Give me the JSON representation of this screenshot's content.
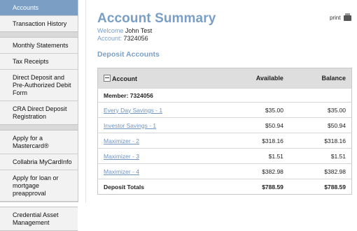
{
  "sidebar": {
    "groups": [
      {
        "items": [
          {
            "label": "Accounts"
          },
          {
            "label": "Transaction History"
          }
        ]
      },
      {
        "items": [
          {
            "label": "Monthly Statements"
          },
          {
            "label": "Tax Receipts"
          },
          {
            "label": "Direct Deposit and Pre-Authorized Debit Form"
          },
          {
            "label": "CRA Direct Deposit Registration"
          }
        ]
      },
      {
        "items": [
          {
            "label": "Apply for a Mastercard®"
          },
          {
            "label": "Collabria MyCardInfo"
          },
          {
            "label": "Apply for loan or mortgage preapproval"
          }
        ]
      },
      {
        "items": [
          {
            "label": "Credential Asset Management"
          }
        ]
      }
    ]
  },
  "header": {
    "title": "Account Summary",
    "print_label": "print",
    "welcome_label": "Welcome",
    "welcome_name": "John Test",
    "account_label": "Account:",
    "account_number": "7324056"
  },
  "deposit": {
    "section_title": "Deposit Accounts",
    "columns": {
      "account": "Account",
      "available": "Available",
      "balance": "Balance"
    },
    "member_row": "Member: 7324056",
    "rows": [
      {
        "name": "Every Day Savings - 1",
        "available": "$35.00",
        "balance": "$35.00"
      },
      {
        "name": "Investor Savings - 1",
        "available": "$50.94",
        "balance": "$50.94"
      },
      {
        "name": "Maximizer - 2",
        "available": "$318.16",
        "balance": "$318.16"
      },
      {
        "name": "Maximizer - 3",
        "available": "$1.51",
        "balance": "$1.51"
      },
      {
        "name": "Maximizer - 4",
        "available": "$382.98",
        "balance": "$382.98"
      }
    ],
    "totals": {
      "label": "Deposit Totals",
      "available": "$788.59",
      "balance": "$788.59"
    }
  }
}
